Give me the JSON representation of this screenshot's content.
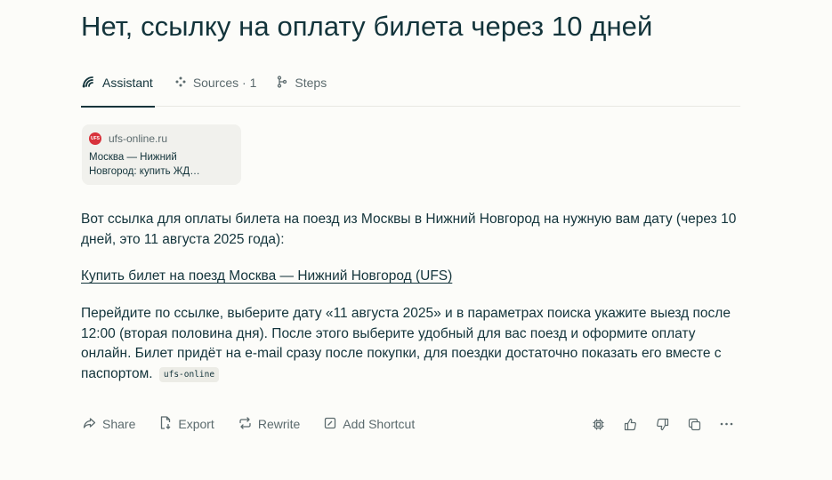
{
  "page": {
    "title": "Нет, ссылку на оплату билета через 10 дней"
  },
  "tabs": [
    {
      "label": "Assistant",
      "icon": "assistant-icon",
      "active": true
    },
    {
      "label": "Sources · 1",
      "icon": "sources-icon",
      "active": false
    },
    {
      "label": "Steps",
      "icon": "steps-icon",
      "active": false
    }
  ],
  "source_card": {
    "favicon_text": "UFS",
    "domain": "ufs-online.ru",
    "title": "Москва — Нижний Новгород: купить ЖД…"
  },
  "answer": {
    "intro": "Вот ссылка для оплаты билета на поезд из Москвы в Нижний Новгород на нужную вам дату (через 10 дней, это 11 августа 2025 года):",
    "link_text": "Купить билет на поезд Москва — Нижний Новгород (UFS)",
    "instructions": "Перейдите по ссылке, выберите дату «11 августа 2025» и в параметрах поиска укажите выезд после 12:00 (вторая половина дня). После этого выберите удобный для вас поезд и оформите оплату онлайн. Билет придёт на e-mail сразу после покупки, для поездки достаточно показать его вместе с паспортом.",
    "citation": "ufs-online"
  },
  "actions": {
    "share": "Share",
    "export": "Export",
    "rewrite": "Rewrite",
    "add_shortcut": "Add Shortcut"
  },
  "icons": {
    "right": [
      "model-chip-icon",
      "thumbs-up-icon",
      "thumbs-down-icon",
      "copy-icon",
      "more-icon"
    ]
  },
  "colors": {
    "background": "#fcfcf9",
    "text": "#13343b",
    "muted": "#5b6a6d",
    "card": "#f1f1ed",
    "favicon": "#d8323b"
  }
}
